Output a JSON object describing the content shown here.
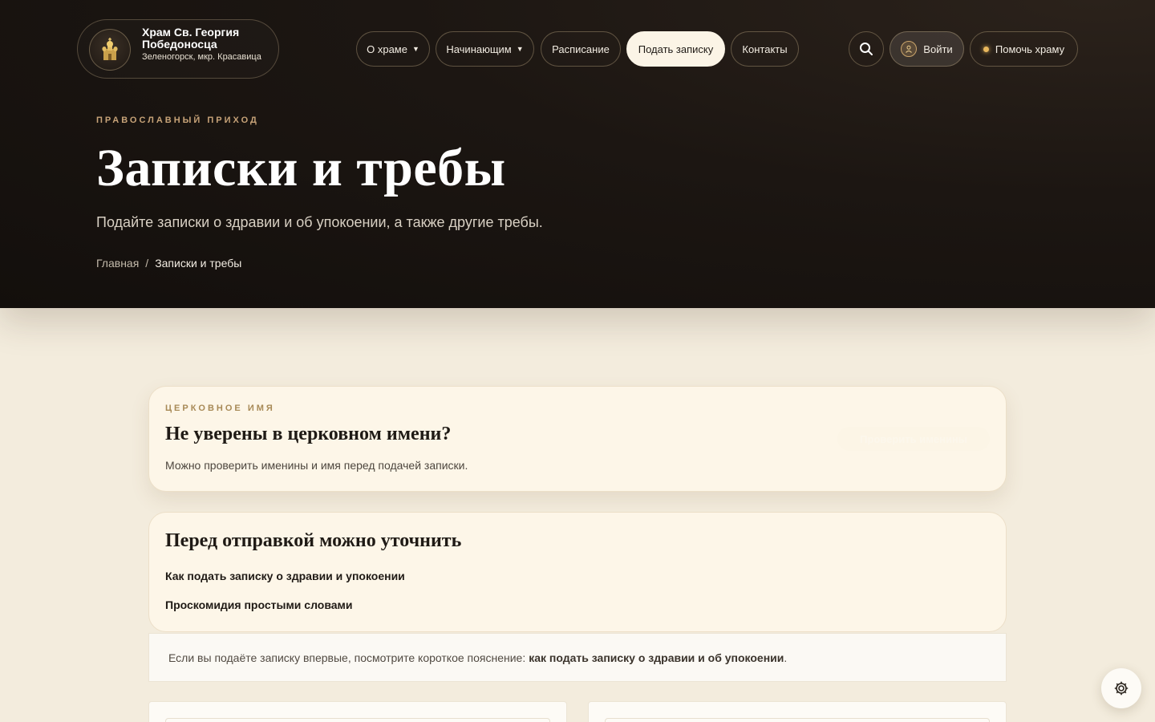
{
  "brand": {
    "name": "Храм Св. Георгия Победоносца",
    "location": "Зеленогорск, мкр. Красавица"
  },
  "nav": {
    "about": "О храме",
    "beginners": "Начинающим",
    "schedule": "Расписание",
    "submit_note": "Подать записку",
    "contacts": "Контакты"
  },
  "header_actions": {
    "login": "Войти",
    "help": "Помочь храму"
  },
  "hero": {
    "eyebrow": "ПРАВОСЛАВНЫЙ ПРИХОД",
    "title": "Записки и требы",
    "subtitle": "Подайте записки о здравии и об упокоении, а также другие требы."
  },
  "breadcrumb": {
    "home": "Главная",
    "separator": "/",
    "current": "Записки и требы"
  },
  "church_name_card": {
    "label": "ЦЕРКОВНОЕ ИМЯ",
    "title": "Не уверены в церковном имени?",
    "description": "Можно проверить именины и имя перед подачей записки.",
    "button": "Проверить именины"
  },
  "clarify_card": {
    "title": "Перед отправкой можно уточнить",
    "links": [
      "Как подать записку о здравии и упокоении",
      "Проскомидия простыми словами"
    ]
  },
  "notice": {
    "text": "Если вы подаёте записку впервые, посмотрите короткое пояснение:",
    "link": "как подать записку о здравии и об упокоении",
    "end": "."
  },
  "colors": {
    "hero_bg": "#1c1612",
    "page_bg": "#f3ecdd",
    "accent_gold": "#c7a378",
    "card_bg": "#fdf6e8"
  }
}
